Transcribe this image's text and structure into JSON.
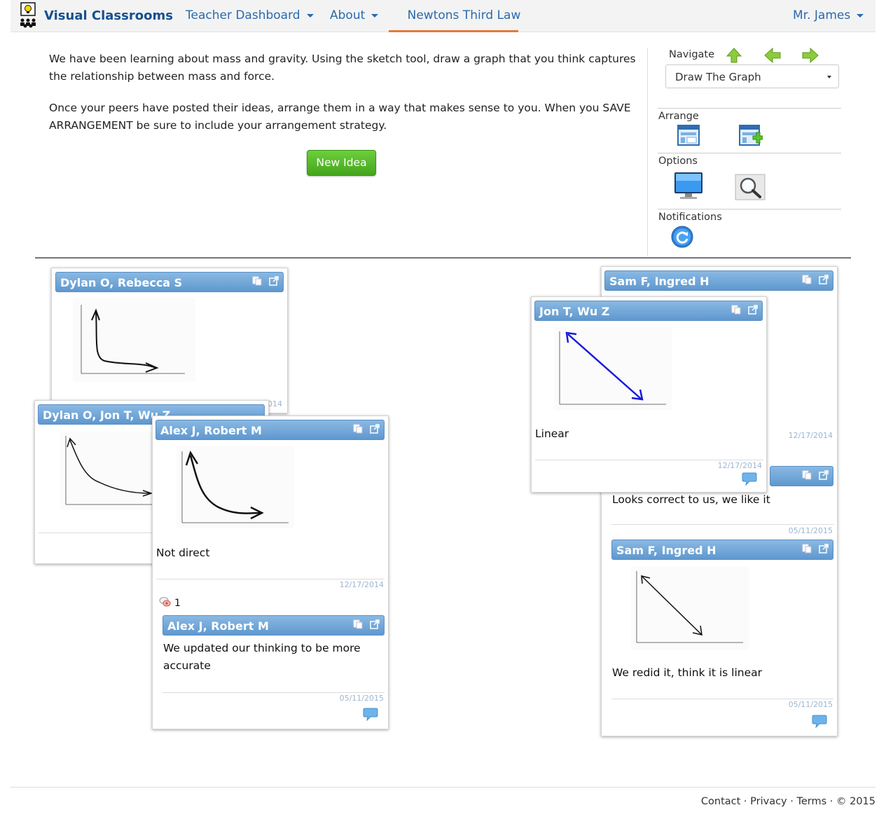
{
  "navbar": {
    "brand": "Visual Classrooms",
    "items": [
      "Teacher Dashboard",
      "About"
    ],
    "active": "Newtons Third Law",
    "user": "Mr. James"
  },
  "intro": {
    "p1": "We have been learning about mass and gravity.  Using the sketch tool, draw a graph that you think captures the relationship between mass and force.",
    "p2": "Once your peers have posted their ideas, arrange them in a way that makes sense to you.  When you SAVE ARRANGEMENT be sure to include your arrangement strategy.",
    "new_idea": "New Idea"
  },
  "side": {
    "navigate": "Navigate",
    "select_value": "Draw The Graph",
    "arrange": "Arrange",
    "options": "Options",
    "notifications": "Notifications"
  },
  "cards": {
    "c1": {
      "title": "Dylan O, Rebecca S",
      "date": "014"
    },
    "c2": {
      "title": "Dylan O, Jon T, Wu Z"
    },
    "c3": {
      "title": "Alex J, Robert M",
      "text": "Not direct",
      "date": "12/17/2014",
      "reply_count": "1",
      "reply": {
        "title": "Alex J, Robert M",
        "text": "We updated our thinking to be more accurate",
        "date": "05/11/2015"
      }
    },
    "c4": {
      "title": "Sam F, Ingred H",
      "date": "12/17/2014",
      "reply1": {
        "text": "Looks correct to us, we like it",
        "date": "05/11/2015"
      },
      "reply2": {
        "title": "Sam F, Ingred H",
        "text": "We redid it, think it is linear",
        "date": "05/11/2015"
      }
    },
    "c5": {
      "title": "Jon T, Wu Z",
      "text": "Linear",
      "date": "12/17/2014"
    }
  },
  "footer": {
    "text": "Contact · Privacy · Terms · © 2015"
  },
  "colors": {
    "accent": "#2a6aad",
    "active_underline": "#e57a3b",
    "card_header": "#6ea6d9",
    "button": "#4fb325"
  }
}
